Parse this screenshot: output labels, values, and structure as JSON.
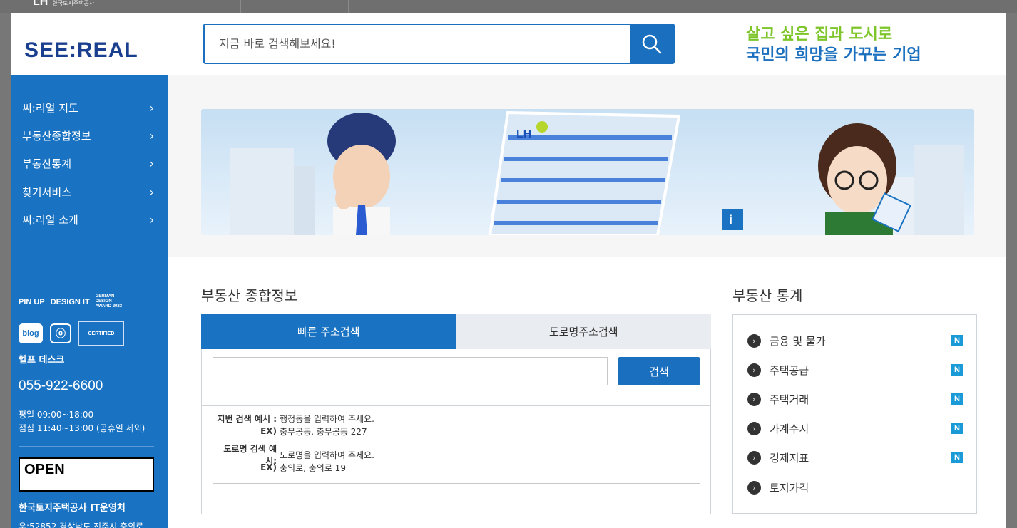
{
  "topbar": {
    "logo": "LH",
    "logo_sub": "한국토지주택공사"
  },
  "header": {
    "brand": "SEE:REAL",
    "search_placeholder": "지금 바로 검색해보세요!",
    "slogan_line1": "살고 싶은 집과 도시로",
    "slogan_line2": "국민의 희망을 가꾸는 기업"
  },
  "sidebar": {
    "items": [
      {
        "label": "씨:리얼 지도"
      },
      {
        "label": "부동산종합정보"
      },
      {
        "label": "부동산통계"
      },
      {
        "label": "찾기서비스"
      },
      {
        "label": "씨:리얼 소개"
      }
    ],
    "awards": [
      "PIN UP",
      "DESIGN IT",
      "GERMAN DESIGN AWARD 2023"
    ],
    "social": {
      "blog": "blog",
      "insta": "ⓞ",
      "cert": "CERTIFIED"
    },
    "help_title": "헬프 데스크",
    "help_phone": "055-922-6600",
    "hours_line1": "평일 09:00~18:00",
    "hours_line2": "점심 11:40~13:00 (공휴일 제외)",
    "open_badge": "OPEN",
    "company": "한국토지주택공사 IT운영처",
    "address": "우:52852 경상남도 진주시 충의로"
  },
  "banner": {
    "logo": "LH"
  },
  "main": {
    "info_title": "부동산 종합정보",
    "tabs": [
      {
        "label": "빠른 주소검색",
        "active": true
      },
      {
        "label": "도로명주소검색",
        "active": false
      }
    ],
    "search_button": "검색",
    "examples": [
      {
        "label": "지번 검색 예시 :",
        "hint": "행정동을 입력하여 주세요.",
        "ex_label": "EX)",
        "ex": "충무공동, 충무공동 227"
      },
      {
        "label": "도로명 검색 예시:",
        "hint": "도로명을 입력하여 주세요.",
        "ex_label": "EX)",
        "ex": "충의로, 충의로 19"
      }
    ],
    "stats_title": "부동산 통계",
    "stats": [
      {
        "label": "금융 및 물가",
        "badge": "N"
      },
      {
        "label": "주택공급",
        "badge": "N"
      },
      {
        "label": "주택거래",
        "badge": "N"
      },
      {
        "label": "가계수지",
        "badge": "N"
      },
      {
        "label": "경제지표",
        "badge": "N"
      },
      {
        "label": "토지가격",
        "badge": ""
      }
    ]
  }
}
